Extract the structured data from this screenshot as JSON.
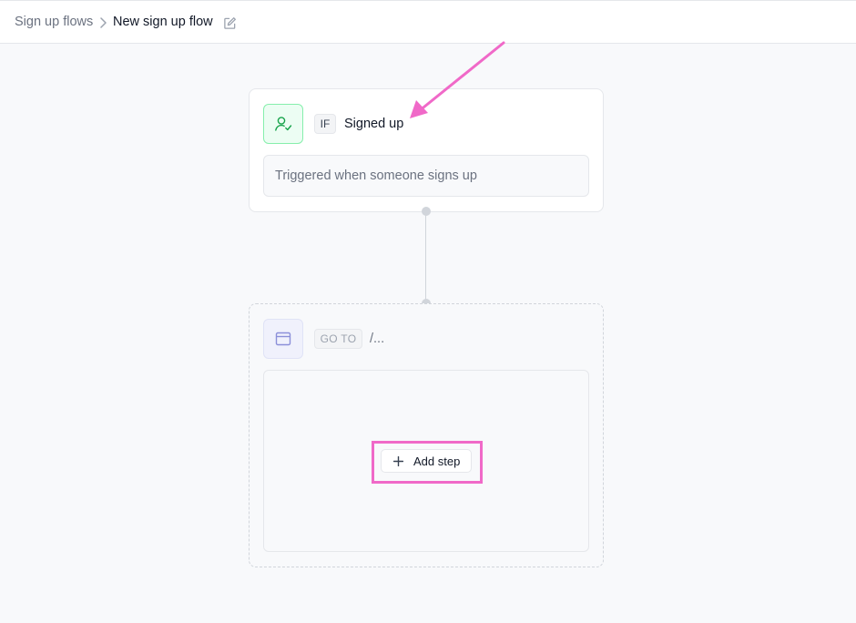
{
  "breadcrumb": {
    "root": "Sign up flows",
    "current": "New sign up flow"
  },
  "trigger": {
    "tag": "IF",
    "title": "Signed up",
    "description": "Triggered when someone signs up",
    "icon": "user-check-icon"
  },
  "goto": {
    "tag": "GO TO",
    "path": "/...",
    "icon": "browser-window-icon"
  },
  "add_step": {
    "label": "Add step"
  },
  "colors": {
    "annotation": "#f069c8",
    "trigger_icon": "#16a34a",
    "goto_icon": "#8b8fd9"
  }
}
